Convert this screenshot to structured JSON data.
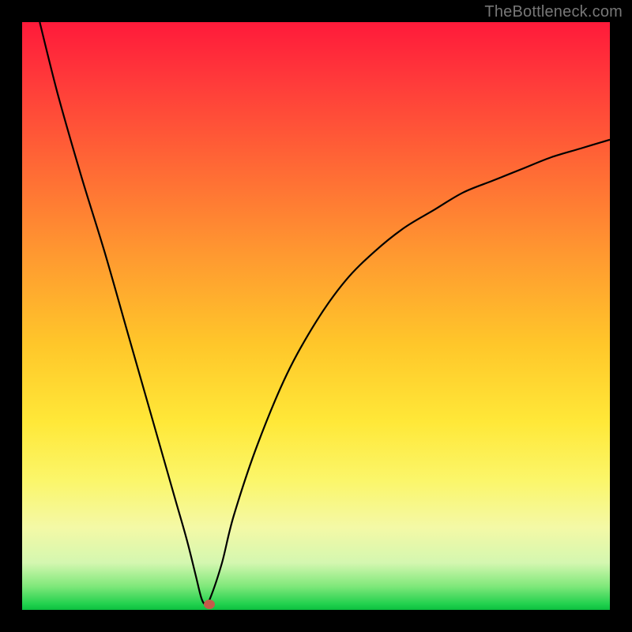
{
  "watermark": "TheBottleneck.com",
  "colors": {
    "curve": "#000000",
    "marker": "#c55a4a",
    "frame": "#000000"
  },
  "chart_data": {
    "type": "line",
    "title": "",
    "xlabel": "",
    "ylabel": "",
    "xlim": [
      0,
      100
    ],
    "ylim": [
      0,
      100
    ],
    "grid": false,
    "legend": false,
    "note": "Values estimated from pixels; no axis ticks or labels are shown in the image.",
    "series": [
      {
        "name": "curve",
        "x": [
          3,
          6,
          10,
          14,
          18,
          22,
          26,
          28,
          29.5,
          30.5,
          31.2,
          32,
          34,
          36,
          40,
          45,
          50,
          55,
          60,
          65,
          70,
          75,
          80,
          85,
          90,
          95,
          100
        ],
        "y": [
          100,
          88,
          74,
          61,
          47,
          33,
          19,
          12,
          6,
          2,
          1,
          2,
          8,
          16,
          28,
          40,
          49,
          56,
          61,
          65,
          68,
          71,
          73,
          75,
          77,
          78.5,
          80
        ]
      }
    ],
    "marker": {
      "x": 31.8,
      "y": 1
    },
    "gradient_stops": [
      {
        "pos": 0.0,
        "color": "#ff1a3a"
      },
      {
        "pos": 0.1,
        "color": "#ff3a3a"
      },
      {
        "pos": 0.25,
        "color": "#ff6a35"
      },
      {
        "pos": 0.4,
        "color": "#ff9a30"
      },
      {
        "pos": 0.55,
        "color": "#ffc72a"
      },
      {
        "pos": 0.68,
        "color": "#ffe838"
      },
      {
        "pos": 0.78,
        "color": "#fbf66a"
      },
      {
        "pos": 0.86,
        "color": "#f4f9a6"
      },
      {
        "pos": 0.92,
        "color": "#d4f7b0"
      },
      {
        "pos": 0.96,
        "color": "#7fe87a"
      },
      {
        "pos": 0.99,
        "color": "#22d14e"
      },
      {
        "pos": 1.0,
        "color": "#0bbf3f"
      }
    ]
  }
}
